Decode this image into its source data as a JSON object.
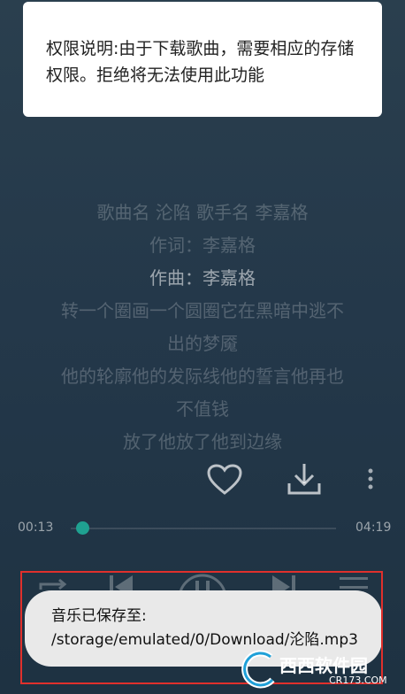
{
  "permission_dialog": {
    "text": "权限说明:由于下载歌曲，需要相应的存储权限。拒绝将无法使用此功能"
  },
  "lyrics": [
    "歌曲名 沦陷 歌手名 李嘉格",
    "作词：李嘉格",
    "作曲：李嘉格",
    "转一个圈画一个圆圈它在黑暗中逃不",
    "出的梦魇",
    "他的轮廓他的发际线他的誓言他再也",
    "不值钱",
    "放了他放了他到边缘"
  ],
  "current_lyric_index": 2,
  "actions": {
    "like_icon": "heart-icon",
    "download_icon": "download-icon",
    "more_icon": "more-vertical-icon"
  },
  "progress": {
    "elapsed": "00:13",
    "total": "04:19",
    "fraction": 0.05
  },
  "controls": {
    "repeat_icon": "repeat-icon",
    "prev_icon": "previous-icon",
    "play_pause_icon": "pause-icon",
    "next_icon": "next-icon",
    "playlist_icon": "playlist-icon"
  },
  "toast": {
    "text": "音乐已保存至: /storage/emulated/0/Download/沦陷.mp3"
  },
  "watermark": {
    "text": "西西软件园",
    "sub": "CR173.COM"
  },
  "colors": {
    "accent": "#1fa191",
    "highlight_border": "#e0302c"
  }
}
